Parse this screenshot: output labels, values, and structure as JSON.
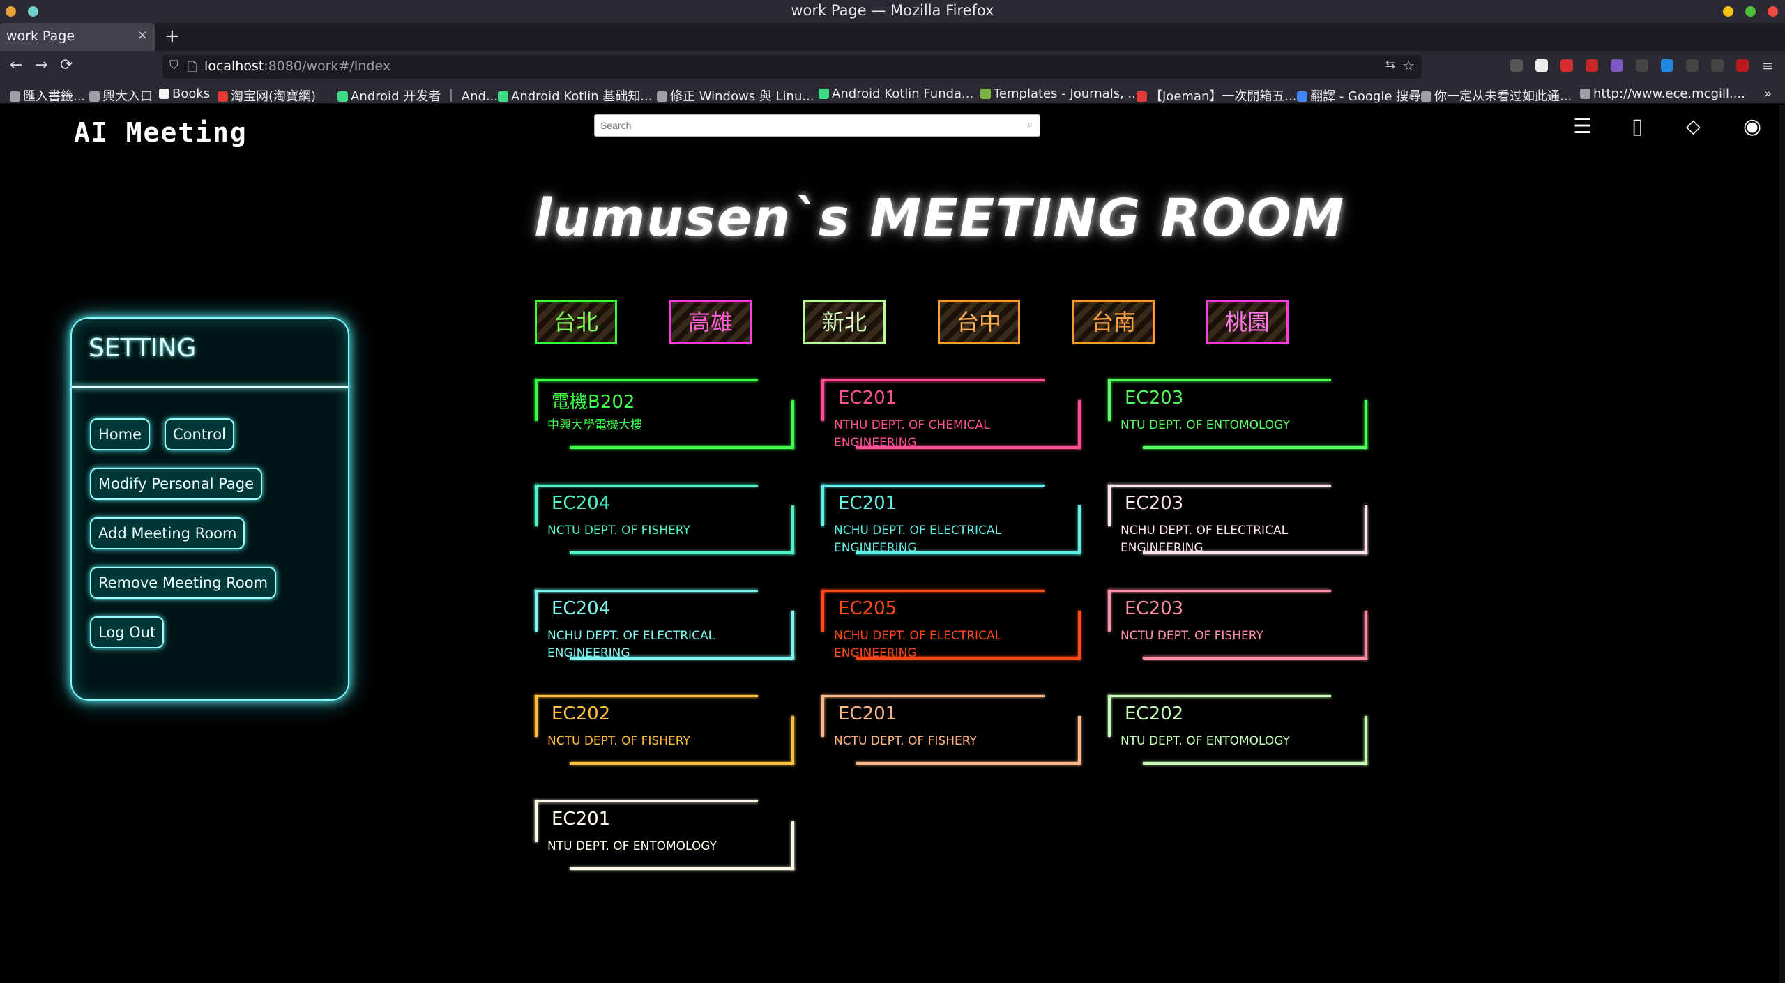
{
  "window": {
    "title": "work Page — Mozilla Firefox"
  },
  "tabs": [
    {
      "label": "work Page",
      "close": "×"
    }
  ],
  "new_tab": "+",
  "nav": {
    "back": "←",
    "forward": "→",
    "reload": "⟳"
  },
  "urlbar": {
    "host": "localhost",
    "path": ":8080/work#/Index"
  },
  "bookmarks": [
    {
      "label": "匯入書籤...",
      "color": "#9aa0a6"
    },
    {
      "label": "興大入口",
      "color": "#9aa0a6"
    },
    {
      "label": "Books",
      "color": "#f5f5f5"
    },
    {
      "label": "淘宝网(淘寶網)",
      "color": "#e53935"
    },
    {
      "label": "Android 开发者 ｜ And...",
      "color": "#3ddc84"
    },
    {
      "label": "Android Kotlin 基础知...",
      "color": "#3ddc84"
    },
    {
      "label": "修正 Windows 與 Linu...",
      "color": "#9aa0a6"
    },
    {
      "label": "Android Kotlin Funda...",
      "color": "#3ddc84"
    },
    {
      "label": "Templates - Journals, ...",
      "color": "#7cb342"
    },
    {
      "label": "【Joeman】一次開箱五...",
      "color": "#e53935"
    },
    {
      "label": "翻譯 - Google 搜尋",
      "color": "#4285f4"
    },
    {
      "label": "你一定从未看过如此通...",
      "color": "#9aa0a6"
    },
    {
      "label": "http://www.ece.mcgill....",
      "color": "#9aa0a6"
    }
  ],
  "site": {
    "logo": "AI Meeting",
    "search_placeholder": "Search",
    "room_title": "lumusen`s MEETING ROOM"
  },
  "cities": [
    {
      "label": "台北",
      "color": "#39ff3a",
      "text": "#7dff5a"
    },
    {
      "label": "高雄",
      "color": "#ff3bdc",
      "text": "#ff5ed8"
    },
    {
      "label": "新北",
      "color": "#b4ff9a",
      "text": "#d8ffc8"
    },
    {
      "label": "台中",
      "color": "#ff9a2e",
      "text": "#ffb25a"
    },
    {
      "label": "台南",
      "color": "#ff9a2e",
      "text": "#ffa040"
    },
    {
      "label": "桃園",
      "color": "#ff3bdc",
      "text": "#ff7ae8"
    }
  ],
  "setting": {
    "title": "SETTING",
    "buttons": {
      "home": "Home",
      "control": "Control",
      "modify": "Modify Personal Page",
      "add": "Add Meeting Room",
      "remove": "Remove Meeting Room",
      "logout": "Log Out"
    }
  },
  "rooms": [
    {
      "name": "電機B202",
      "sub": "中興大學電機大樓",
      "color": "#3dff4a"
    },
    {
      "name": "EC201",
      "sub": "NTHU DEPT. OF CHEMICAL ENGINEERING",
      "color": "#ff4f93"
    },
    {
      "name": "EC203",
      "sub": "NTU DEPT. OF ENTOMOLOGY",
      "color": "#53ff5b"
    },
    {
      "name": "EC204",
      "sub": "NCTU DEPT. OF FISHERY",
      "color": "#52f2c8"
    },
    {
      "name": "EC201",
      "sub": "NCHU DEPT. OF ELECTRICAL ENGINEERING",
      "color": "#5ff0e6"
    },
    {
      "name": "EC203",
      "sub": "NCHU DEPT. OF ELECTRICAL ENGINEERING",
      "color": "#ffe4ea"
    },
    {
      "name": "EC204",
      "sub": "NCHU DEPT. OF ELECTRICAL ENGINEERING",
      "color": "#7ef6ef"
    },
    {
      "name": "EC205",
      "sub": "NCHU DEPT. OF ELECTRICAL ENGINEERING",
      "color": "#ff4a18"
    },
    {
      "name": "EC203",
      "sub": "NCTU DEPT. OF FISHERY",
      "color": "#ff8fa8"
    },
    {
      "name": "EC202",
      "sub": "NCTU DEPT. OF FISHERY",
      "color": "#ffbf3a"
    },
    {
      "name": "EC201",
      "sub": "NCTU DEPT. OF FISHERY",
      "color": "#ffb585"
    },
    {
      "name": "EC202",
      "sub": "NTU DEPT. OF ENTOMOLOGY",
      "color": "#c8ffb8"
    },
    {
      "name": "EC201",
      "sub": "NTU DEPT. OF ENTOMOLOGY",
      "color": "#fffbe6"
    }
  ]
}
